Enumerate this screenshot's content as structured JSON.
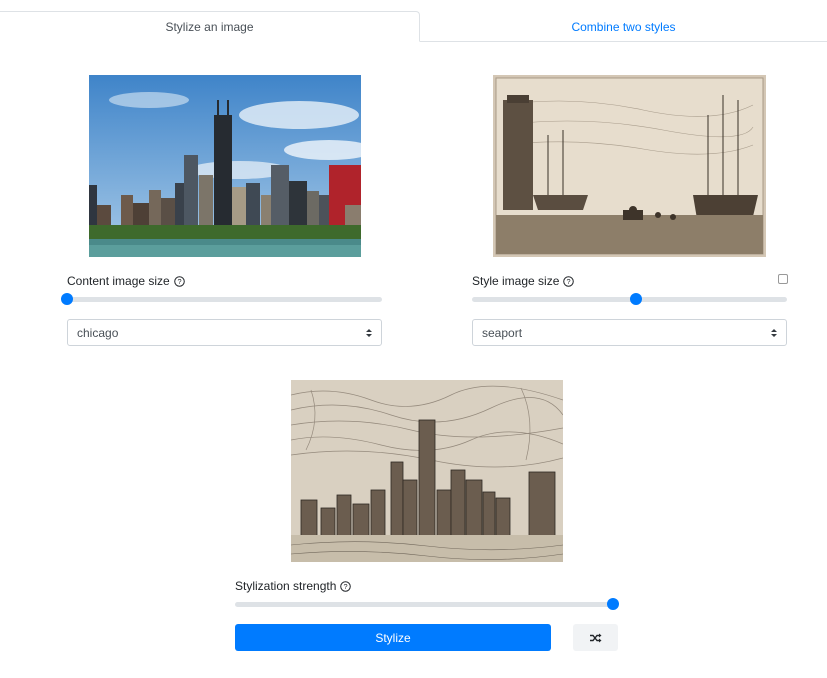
{
  "tabs": [
    {
      "label": "Stylize an image",
      "active": true
    },
    {
      "label": "Combine two styles",
      "active": false
    }
  ],
  "content": {
    "size_label": "Content image size",
    "size_level": 0.0,
    "selected": "chicago"
  },
  "style": {
    "size_label": "Style image size",
    "size_level": 0.52,
    "selected": "seaport",
    "checkbox_checked": false
  },
  "stylization": {
    "label": "Stylization strength",
    "level": 1.0
  },
  "buttons": {
    "stylize_label": "Stylize",
    "random_icon": "shuffle-icon"
  },
  "colors": {
    "accent": "#007bff",
    "track": "#dee2e6"
  }
}
